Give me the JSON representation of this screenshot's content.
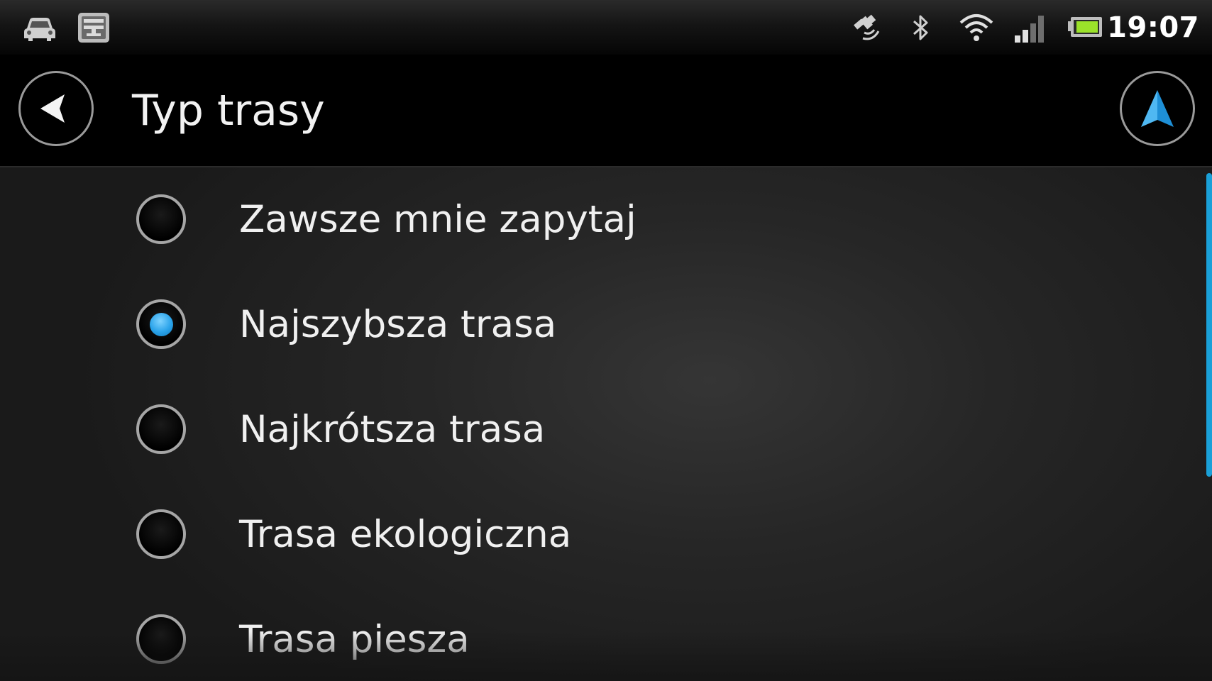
{
  "status_bar": {
    "time": "19:07",
    "icons": [
      "car-icon",
      "notification-icon",
      "gps-icon",
      "bluetooth-icon",
      "wifi-icon",
      "signal-icon",
      "battery-icon"
    ]
  },
  "header": {
    "title": "Typ trasy",
    "back_icon": "back-arrow-icon",
    "navigation_icon": "navigation-arrow-icon"
  },
  "options": [
    {
      "label": "Zawsze mnie zapytaj",
      "selected": false
    },
    {
      "label": "Najszybsza trasa",
      "selected": true
    },
    {
      "label": "Najkrótsza trasa",
      "selected": false
    },
    {
      "label": "Trasa ekologiczna",
      "selected": false
    },
    {
      "label": "Trasa piesza",
      "selected": false
    }
  ],
  "colors": {
    "accent": "#2aa3ea",
    "scrollbar": "#1aa0d8",
    "background": "#1c1c1c"
  }
}
